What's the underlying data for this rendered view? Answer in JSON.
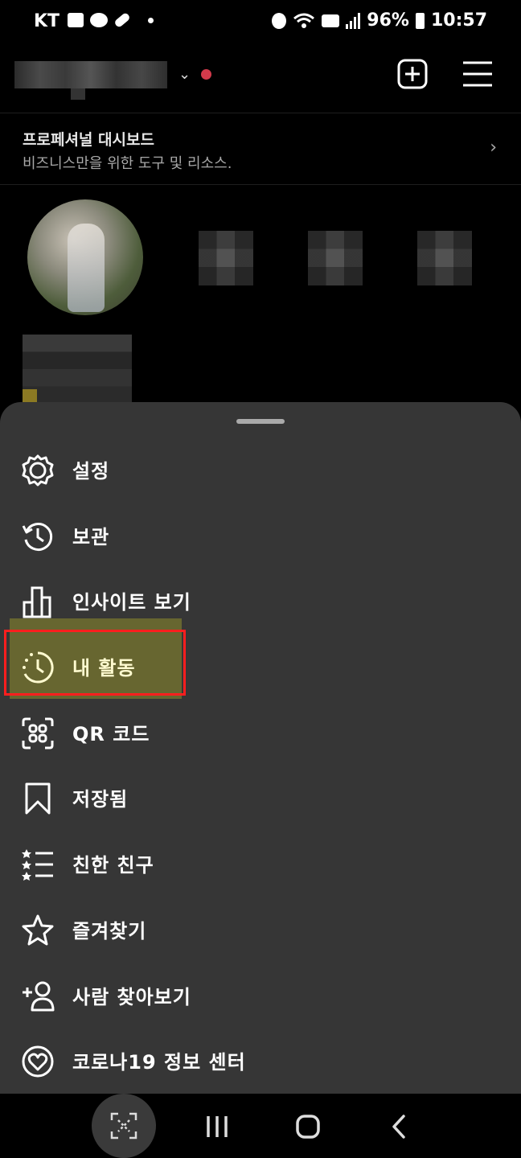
{
  "status_bar": {
    "carrier": "KT",
    "battery": "96%",
    "time": "10:57",
    "notification_icons": [
      "gallery-icon",
      "kakaotalk-icon",
      "pill-icon"
    ],
    "system_icons": [
      "alarm-icon",
      "wifi-icon",
      "hd-icon",
      "signal-icon",
      "battery-icon"
    ]
  },
  "pro_dashboard": {
    "title": "프로페셔널 대시보드",
    "subtitle": "비즈니스만을 위한 도구 및 리소스."
  },
  "menu": {
    "items": [
      {
        "label": "설정",
        "icon": "gear-icon"
      },
      {
        "label": "보관",
        "icon": "archive-history-icon"
      },
      {
        "label": "인사이트 보기",
        "icon": "bar-chart-icon"
      },
      {
        "label": "내 활동",
        "icon": "activity-clock-icon",
        "highlighted": true
      },
      {
        "label": "QR 코드",
        "icon": "qr-code-icon"
      },
      {
        "label": "저장됨",
        "icon": "bookmark-icon"
      },
      {
        "label": "친한 친구",
        "icon": "close-friends-list-icon"
      },
      {
        "label": "즐겨찾기",
        "icon": "star-icon"
      },
      {
        "label": "사람 찾아보기",
        "icon": "add-person-icon"
      },
      {
        "label": "코로나19 정보 센터",
        "icon": "covid-heart-icon"
      }
    ]
  },
  "nav_bar": {
    "buttons": [
      "screen-capture-icon",
      "recent-apps-icon",
      "home-icon",
      "back-icon"
    ]
  },
  "colors": {
    "background": "#000000",
    "sheet": "#363636",
    "highlight_fill": "#676630",
    "highlight_border": "#ff1e1e",
    "notification_dot": "#d23a4b"
  }
}
